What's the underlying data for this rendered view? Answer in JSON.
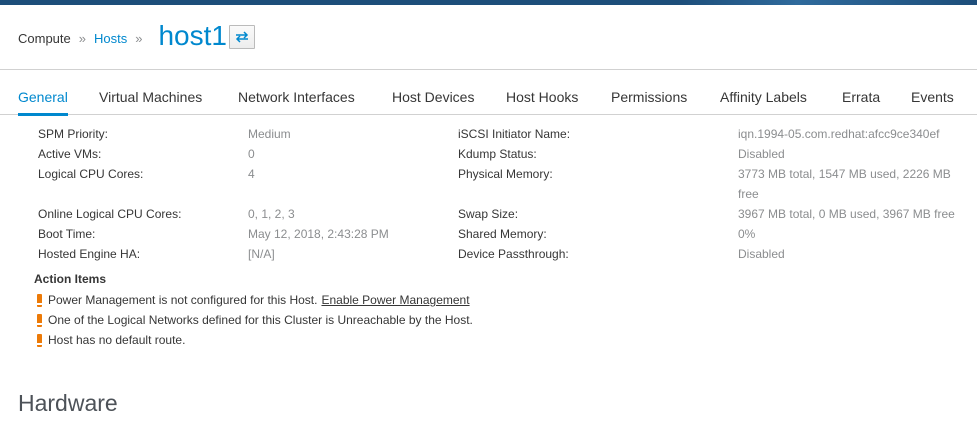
{
  "breadcrumb": {
    "root": "Compute",
    "separator": "»",
    "parent": "Hosts",
    "current": "host1"
  },
  "header": {
    "swap_icon": "swap-arrows-icon"
  },
  "tabs": [
    {
      "label": "General",
      "active": true
    },
    {
      "label": "Virtual Machines"
    },
    {
      "label": "Network Interfaces"
    },
    {
      "label": "Host Devices"
    },
    {
      "label": "Host Hooks"
    },
    {
      "label": "Permissions"
    },
    {
      "label": "Affinity Labels"
    },
    {
      "label": "Errata"
    },
    {
      "label": "Events"
    }
  ],
  "left_props": [
    {
      "label": "SPM Priority:",
      "value": "Medium"
    },
    {
      "label": "Active VMs:",
      "value": "0"
    },
    {
      "label": "Logical CPU Cores:",
      "value": "4"
    },
    {
      "label": "Online Logical CPU Cores:",
      "value": "0, 1, 2, 3"
    },
    {
      "label": "Boot Time:",
      "value": "May 12, 2018, 2:43:28 PM"
    },
    {
      "label": "Hosted Engine HA:",
      "value": "[N/A]"
    }
  ],
  "right_props": [
    {
      "label": "iSCSI Initiator Name:",
      "value": "iqn.1994-05.com.redhat:afcc9ce340ef"
    },
    {
      "label": "Kdump Status:",
      "value": "Disabled"
    },
    {
      "label": "Physical Memory:",
      "value": "3773 MB total, 1547 MB used, 2226 MB",
      "value2": "free"
    },
    {
      "label": "Swap Size:",
      "value": "3967 MB total, 0 MB used, 3967 MB free"
    },
    {
      "label": "Shared Memory:",
      "value": "0%"
    },
    {
      "label": "Device Passthrough:",
      "value": "Disabled"
    }
  ],
  "action_items": {
    "title": "Action Items",
    "items": [
      {
        "text": "Power Management is not configured for this Host.",
        "link": "Enable Power Management"
      },
      {
        "text": "One of the Logical Networks defined for this Cluster is Unreachable by the Host."
      },
      {
        "text": "Host has no default route."
      }
    ]
  },
  "hardware": {
    "title": "Hardware"
  },
  "colors": {
    "accent": "#0088ce",
    "warning": "#ec7a08",
    "stripe": "#1d4e7a"
  }
}
